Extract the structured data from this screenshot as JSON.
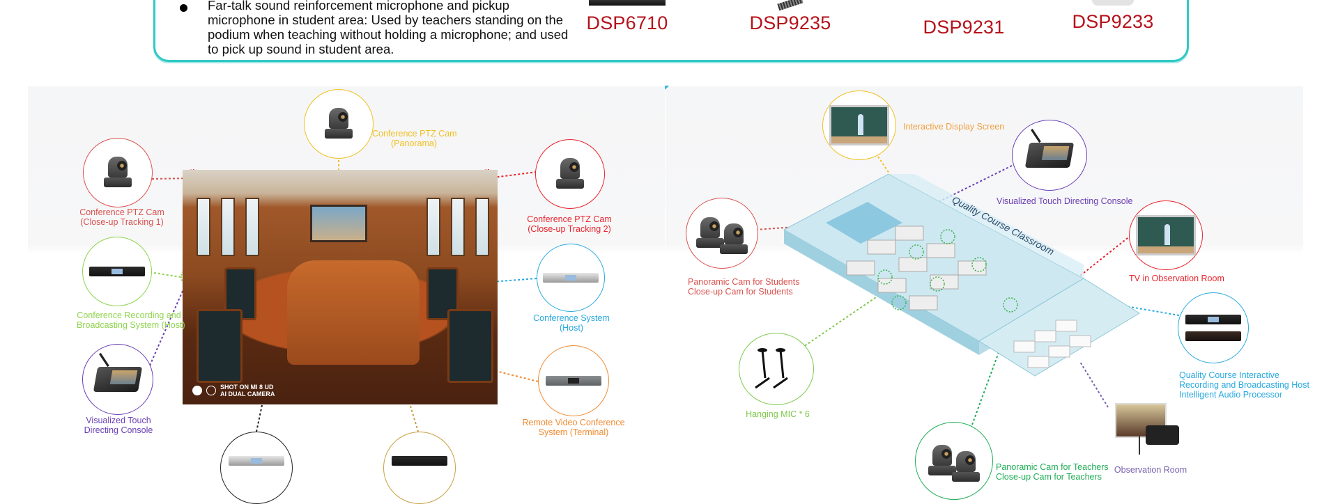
{
  "spec_box": {
    "bullet_text": "Far-talk sound reinforcement microphone and pickup microphone in student area: Used by teachers standing on the podium when teaching without holding a microphone; and used to pick up sound in student area.",
    "products": [
      {
        "model": "DSP6710"
      },
      {
        "model": "DSP9235"
      },
      {
        "model": "DSP9231"
      },
      {
        "model": "DSP9233"
      }
    ],
    "border_color": "#2ec9c6",
    "model_color": "#b5121b"
  },
  "conference_panel": {
    "photo_watermark": {
      "line1": "SHOT ON MI 8 UD",
      "line2": "AI DUAL CAMERA"
    },
    "devices": [
      {
        "label": "Conference PTZ Cam (Close-up Tracking 1)",
        "line1": "Conference PTZ Cam",
        "line2": "(Close-up Tracking 1)",
        "color": "#d9534f"
      },
      {
        "label": "Conference PTZ Cam (Panorama)",
        "line1": "Conference PTZ Cam",
        "line2": "(Panorama)",
        "color": "#f0c020"
      },
      {
        "label": "Conference PTZ Cam (Close-up Tracking 2)",
        "line1": "Conference PTZ Cam",
        "line2": "(Close-up Tracking 2)",
        "color": "#e8242c"
      },
      {
        "label": "Conference Recording and Broadcasting System (Host)",
        "line1": "Conference Recording and",
        "line2": "Broadcasting System (Host)",
        "color": "#8fd44e"
      },
      {
        "label": "Conference System (Host)",
        "line1": "Conference System",
        "line2": "(Host)",
        "color": "#29a9e0"
      },
      {
        "label": "Visualized Touch Directing Console",
        "line1": "Visualized Touch",
        "line2": "Directing Console",
        "color": "#6a3fb5"
      },
      {
        "label": "Remote Video Conference System (Terminal)",
        "line1": "Remote Video Conference",
        "line2": "System (Terminal)",
        "color": "#f08a30"
      },
      {
        "label": "",
        "line1": "",
        "line2": "",
        "color": "#222222"
      },
      {
        "label": "",
        "line1": "",
        "line2": "",
        "color": "#c8a040"
      }
    ]
  },
  "classroom_panel": {
    "room_title": "Quality Course Classroom",
    "devices": [
      {
        "line1": "Interactive Display Screen",
        "line2": "",
        "color": "#f0a040"
      },
      {
        "line1": "Visualized Touch Directing Console",
        "line2": "",
        "color": "#6a3fb5"
      },
      {
        "line1": "Panoramic Cam for Students",
        "line2": "Close-up Cam for Students",
        "color": "#d9534f"
      },
      {
        "line1": "TV in Observation Room",
        "line2": "",
        "color": "#e8242c"
      },
      {
        "line1": "Hanging MIC * 6",
        "line2": "",
        "color": "#7cc84a"
      },
      {
        "line1": "Quality Course Interactive",
        "line2": "Recording and Broadcasting Host",
        "line3": "Intelligent Audio Processor",
        "color": "#29a9e0"
      },
      {
        "line1": "Panoramic Cam for Teachers",
        "line2": "Close-up Cam for Teachers",
        "color": "#1fae55"
      },
      {
        "line1": "Observation Room",
        "line2": "",
        "color": "#7a62b0"
      }
    ]
  }
}
